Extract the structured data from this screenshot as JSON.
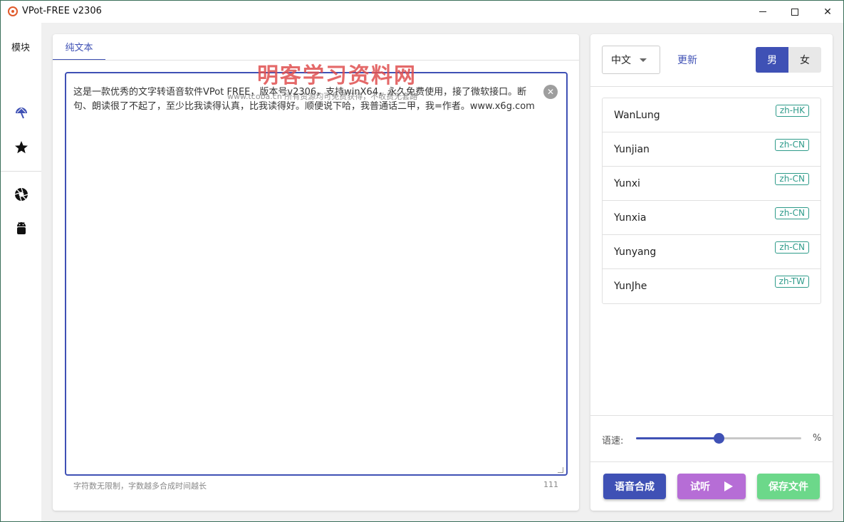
{
  "window": {
    "title": "VPot-FREE v2306",
    "controls": {
      "minimize": "",
      "maximize": "",
      "close": "✕"
    }
  },
  "sidebar": {
    "label": "模块",
    "icons": [
      "umbrella-icon",
      "star-icon",
      "aperture-icon",
      "android-icon"
    ]
  },
  "editor": {
    "tab": "纯文本",
    "text": "这是一款优秀的文字转语音软件VPot FREE，版本号v2306，支持winX64，永久免费使用，接了微软接口。断句、朗读很了不起了，至少比我读得认真，比我读得好。顺便说下哈，我普通话二甲，我=作者。www.x6g.com",
    "hint": "字符数无限制，字数越多合成时间越长",
    "char_count": "111",
    "clear_icon": "✕"
  },
  "watermark": {
    "title": "明客学习资料网",
    "sub": "www.tcoba.cn    所有资源均可免费获得，不收费无套路"
  },
  "voice_panel": {
    "language": "中文",
    "update_label": "更新",
    "gender_male": "男",
    "gender_female": "女",
    "selected_gender": "男",
    "voices": [
      {
        "name": "WanLung",
        "locale": "zh-HK"
      },
      {
        "name": "Yunjian",
        "locale": "zh-CN"
      },
      {
        "name": "Yunxi",
        "locale": "zh-CN"
      },
      {
        "name": "Yunxia",
        "locale": "zh-CN"
      },
      {
        "name": "Yunyang",
        "locale": "zh-CN"
      },
      {
        "name": "YunJhe",
        "locale": "zh-TW"
      }
    ],
    "speed_label": "语速:",
    "speed_unit": "%",
    "speed_value": 0.5
  },
  "actions": {
    "synthesize": "语音合成",
    "listen": "试听",
    "save": "保存文件"
  },
  "colors": {
    "accent": "#3f51b5",
    "listen": "#b66dd6",
    "save": "#6cd88a",
    "locale_tag": "#2e9b8a"
  }
}
